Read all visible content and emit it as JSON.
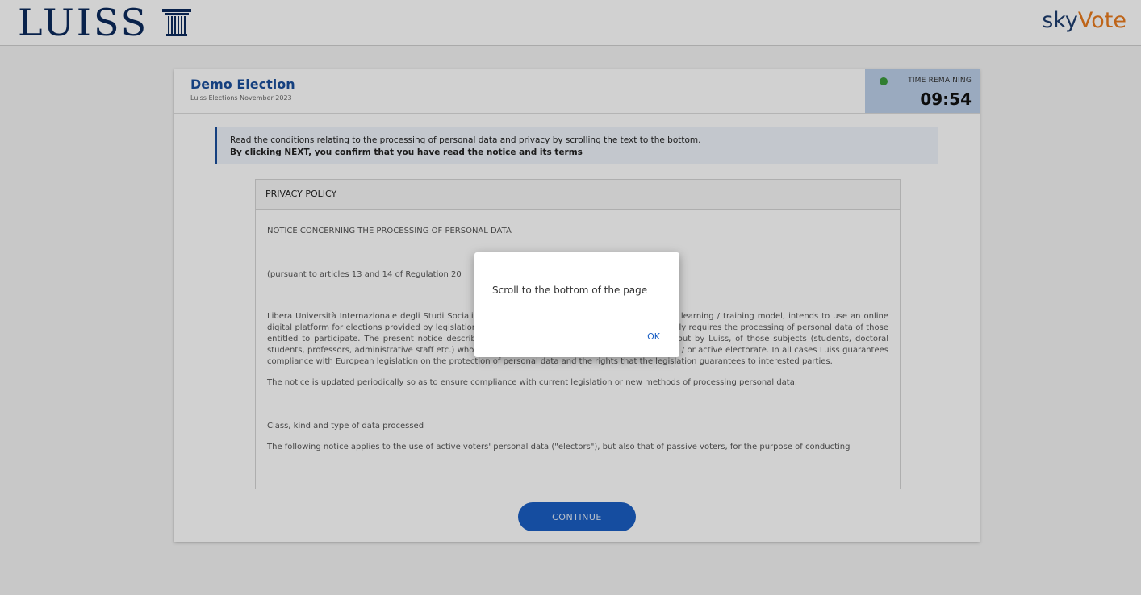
{
  "header": {
    "logo_text": "LUISS",
    "brand_sky": "sky",
    "brand_vote": "Vote"
  },
  "election": {
    "title": "Demo Election",
    "subtitle": "Luiss Elections November 2023"
  },
  "timer": {
    "label": "TIME REMAINING",
    "value": "09:54",
    "status_color": "#3c9a3c"
  },
  "notice": {
    "line1": "Read the conditions relating to the processing of personal data and privacy by scrolling the text to the bottom.",
    "line2": "By clicking NEXT, you confirm that you have read the notice and its terms"
  },
  "policy": {
    "title": "PRIVACY POLICY",
    "heading": "NOTICE CONCERNING THE PROCESSING OF PERSONAL DATA",
    "article": "(pursuant to articles 13 and 14 of Regulation 20",
    "para1": "Libera Università Internazionale degli Studi Sociali Guido Carli, a university that offers an advanced learning / training model, intends to use an online digital platform for elections provided by legislation or university regulations. Online voting necessarily requires the processing of personal data of those entitled to participate. The present notice describes the characteristics of the processing carried out by Luiss, of those subjects (students, doctoral students, professors, administrative staff etc.) who may from time to time constitute the passive and / or active electorate. In all cases Luiss guarantees compliance with European legislation on the protection of personal data and the rights that the legislation guarantees to interested parties.",
    "para2": "The notice is updated periodically so as to ensure compliance with current legislation or new methods of processing personal data.",
    "section": "Class, kind and type of data processed",
    "para3": "The following notice applies to the use of active voters' personal data (\"electors\"), but also that of passive voters, for the purpose of conducting"
  },
  "footer": {
    "continue_label": "CONTINUE"
  },
  "dialog": {
    "message": "Scroll to the bottom of the page",
    "ok_label": "OK"
  },
  "colors": {
    "accent": "#1a4f9c",
    "button": "#1a5fc4",
    "brand_orange": "#e87a1e",
    "timer_bg": "#bcd0ea"
  }
}
